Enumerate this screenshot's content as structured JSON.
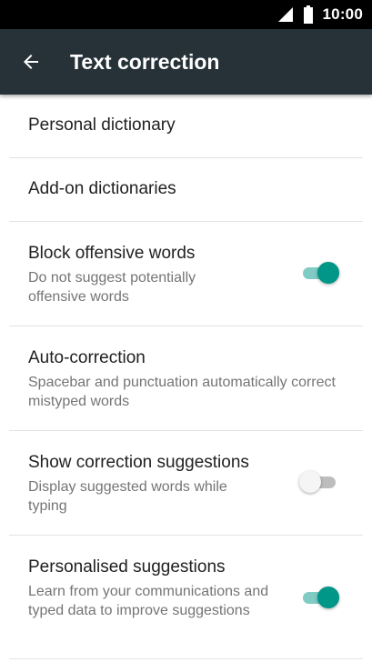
{
  "status_bar": {
    "time": "10:00",
    "icons": [
      "signal-icon",
      "battery-icon"
    ]
  },
  "app_bar": {
    "title": "Text correction",
    "back_icon": "arrow-back-icon",
    "background": "#263238"
  },
  "accent_color": "#009688",
  "items": [
    {
      "title": "Personal dictionary"
    },
    {
      "title": "Add-on dictionaries"
    },
    {
      "title": "Block offensive words",
      "summary": "Do not suggest potentially offensive words",
      "toggle": true
    },
    {
      "title": "Auto-correction",
      "summary": "Spacebar and punctuation automatically correct mistyped words"
    },
    {
      "title": "Show correction suggestions",
      "summary": "Display suggested words while typing",
      "toggle": false
    },
    {
      "title": "Personalised suggestions",
      "summary": "Learn from your communications and typed data to improve suggestions",
      "toggle": true
    }
  ]
}
